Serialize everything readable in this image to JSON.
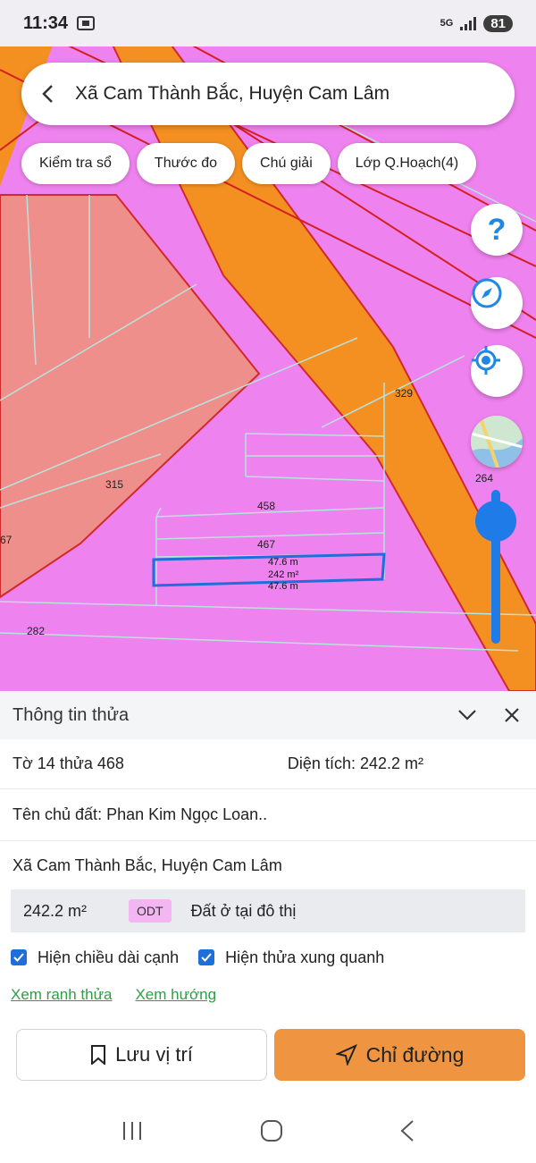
{
  "status_bar": {
    "time": "11:34",
    "network": "5G",
    "battery": "81"
  },
  "search": {
    "text": "Xã Cam Thành Bắc, Huyện Cam Lâm"
  },
  "chips": [
    "Kiểm tra sổ",
    "Thước đo",
    "Chú giải",
    "Lớp Q.Hoạch(4)"
  ],
  "map": {
    "parcel_labels": [
      "329",
      "264",
      "315",
      "458",
      "467",
      "282",
      "67"
    ],
    "selected_parcel": {
      "edge_top": "47.6 m",
      "area": "242 m²",
      "edge_bottom": "47.6 m"
    },
    "colors": {
      "residential": "#ee82ee",
      "road": "#f39021",
      "farmland": "#ef8f8b",
      "highlight": "#1e6fd9"
    }
  },
  "sheet": {
    "title": "Thông tin thửa",
    "parcel_id": "Tờ 14 thửa 468",
    "area_label": "Diện tích: 242.2 m²",
    "owner": "Tên chủ đất: Phan Kim Ngọc Loan..",
    "address": "Xã Cam Thành Bắc, Huyện Cam Lâm",
    "land_use": {
      "area": "242.2 m²",
      "code": "ODT",
      "description": "Đất ở tại đô thị"
    },
    "checkboxes": [
      {
        "label": "Hiện chiều dài cạnh",
        "checked": true
      },
      {
        "label": "Hiện thửa xung quanh",
        "checked": true
      }
    ],
    "links": [
      "Xem ranh thửa",
      "Xem hướng"
    ],
    "save_label": "Lưu vị trí",
    "route_label": "Chỉ đường"
  }
}
